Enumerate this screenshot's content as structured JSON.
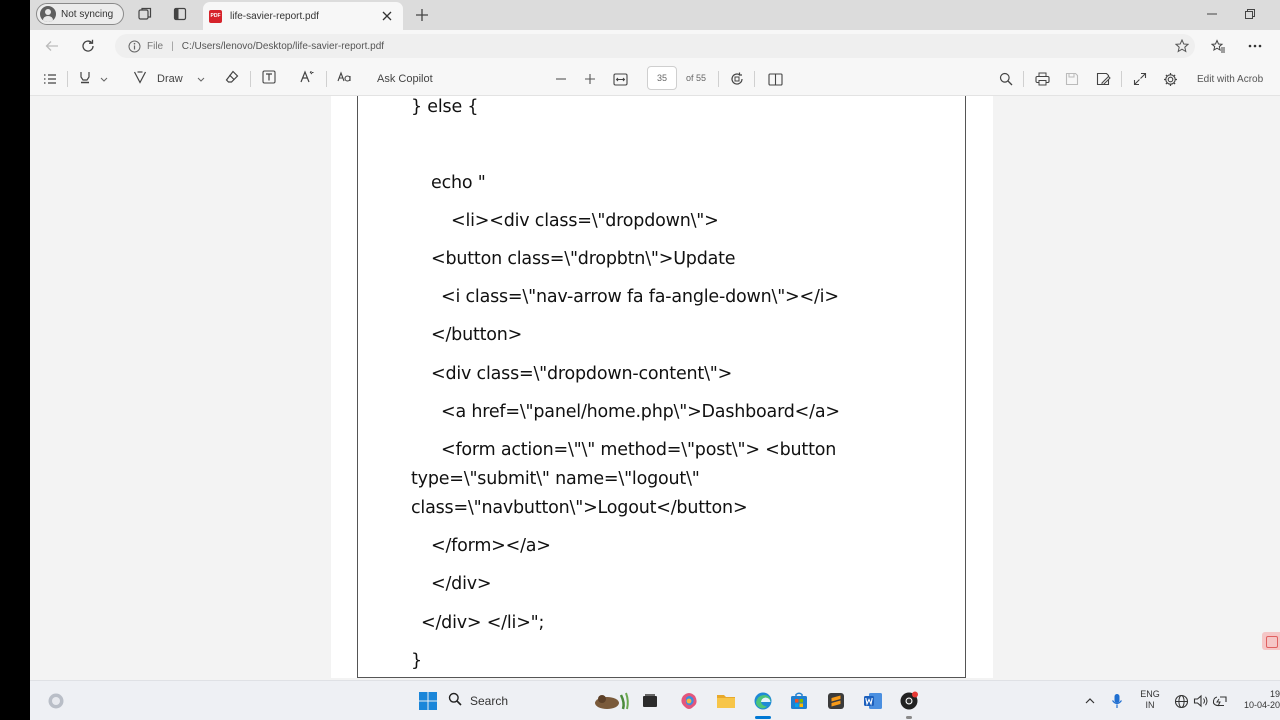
{
  "browser": {
    "profile": {
      "label": "Not syncing"
    },
    "tab": {
      "title": "life-savier-report.pdf",
      "favicon": "pdf-icon"
    },
    "address": {
      "file_label": "File",
      "separator": "|",
      "url": "C:/Users/lenovo/Desktop/life-savier-report.pdf"
    }
  },
  "pdf_toolbar": {
    "draw_label": "Draw",
    "ask_copilot_label": "Ask Copilot",
    "page_current": "35",
    "page_total": "of 55",
    "edit_label": "Edit with Acrob"
  },
  "document": {
    "lines": [
      "} else {",
      "echo \"",
      "<li><div class=\\\"dropdown\\\">",
      "<button class=\\\"dropbtn\\\">Update",
      "<i class=\\\"nav-arrow fa fa-angle-down\\\"></i>",
      "</button>",
      "<div class=\\\"dropdown-content\\\">",
      "<a href=\\\"panel/home.php\\\">Dashboard</a>",
      "<form action=\\\"\\\" method=\\\"post\\\"> <button",
      "type=\\\"submit\\\" name=\\\"logout\\\"",
      "class=\\\"navbutton\\\">Logout</button>",
      "</form></a>",
      "</div>",
      "</div> </li>\";",
      "}"
    ]
  },
  "taskbar": {
    "search_label": "Search",
    "lang_top": "ENG",
    "lang_bottom": "IN",
    "time": "19",
    "date": "10-04-20"
  },
  "colors": {
    "pdf_red": "#d6232b",
    "accent_blue": "#0078d4"
  }
}
